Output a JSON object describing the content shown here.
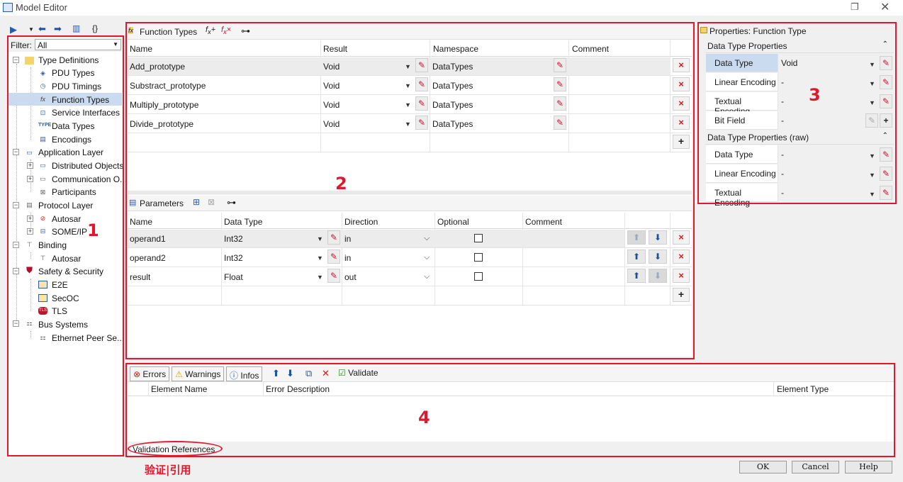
{
  "window": {
    "title": "Model Editor",
    "restore_icon": "restore-icon",
    "close_icon": "close-icon"
  },
  "left": {
    "filter_label": "Filter:",
    "filter_value": "All",
    "tree": {
      "type_definitions": "Type Definitions",
      "pdu_types": "PDU Types",
      "pdu_timings": "PDU Timings",
      "function_types": "Function Types",
      "service_interfaces": "Service Interfaces",
      "data_types": "Data Types",
      "encodings": "Encodings",
      "application_layer": "Application Layer",
      "distributed_objects": "Distributed Objects",
      "communication": "Communication O...",
      "participants": "Participants",
      "protocol_layer": "Protocol Layer",
      "autosar": "Autosar",
      "someip": "SOME/IP",
      "binding": "Binding",
      "binding_autosar": "Autosar",
      "safety_security": "Safety & Security",
      "e2e": "E2E",
      "secoc": "SecOC",
      "tls": "TLS",
      "tls_icon": "TLS",
      "bus_systems": "Bus Systems",
      "ethernet_peer": "Ethernet Peer Se..."
    }
  },
  "function_types": {
    "title": "Function Types",
    "columns": [
      "Name",
      "Result",
      "Namespace",
      "Comment"
    ],
    "rows": [
      {
        "name": "Add_prototype",
        "result": "Void",
        "namespace": "DataTypes"
      },
      {
        "name": "Substract_prototype",
        "result": "Void",
        "namespace": "DataTypes"
      },
      {
        "name": "Multiply_prototype",
        "result": "Void",
        "namespace": "DataTypes"
      },
      {
        "name": "Divide_prototype",
        "result": "Void",
        "namespace": "DataTypes"
      }
    ]
  },
  "parameters": {
    "title": "Parameters",
    "columns": [
      "Name",
      "Data Type",
      "Direction",
      "Optional",
      "Comment"
    ],
    "rows": [
      {
        "name": "operand1",
        "data_type": "Int32",
        "direction": "in",
        "optional": false
      },
      {
        "name": "operand2",
        "data_type": "Int32",
        "direction": "in",
        "optional": false
      },
      {
        "name": "result",
        "data_type": "Float",
        "direction": "out",
        "optional": false
      }
    ]
  },
  "properties": {
    "title": "Properties: Function Type",
    "section1": "Data Type Properties",
    "section2": "Data Type Properties (raw)",
    "rows1": [
      {
        "label": "Data Type",
        "value": "Void"
      },
      {
        "label": "Linear Encoding",
        "value": "-"
      },
      {
        "label": "Textual Encoding",
        "value": "-"
      },
      {
        "label": "Bit Field",
        "value": "-"
      }
    ],
    "rows2": [
      {
        "label": "Data Type",
        "value": "-"
      },
      {
        "label": "Linear Encoding",
        "value": "-"
      },
      {
        "label": "Textual Encoding",
        "value": "-"
      }
    ]
  },
  "messages": {
    "errors": "Errors",
    "warnings": "Warnings",
    "infos": "Infos",
    "validate": "Validate",
    "columns": [
      "Element Name",
      "Error Description",
      "Element Type"
    ],
    "tab_validation": "Validation",
    "tab_references": "References"
  },
  "annotations": {
    "n1": "1",
    "n2": "2",
    "n3": "3",
    "n4": "4",
    "caption": "验证|引用"
  },
  "buttons": {
    "ok": "OK",
    "cancel": "Cancel",
    "help": "Help"
  },
  "colors": {
    "annotation_red": "#e0182d",
    "selection": "#cbdbef",
    "accent": "#2a5aa8"
  }
}
